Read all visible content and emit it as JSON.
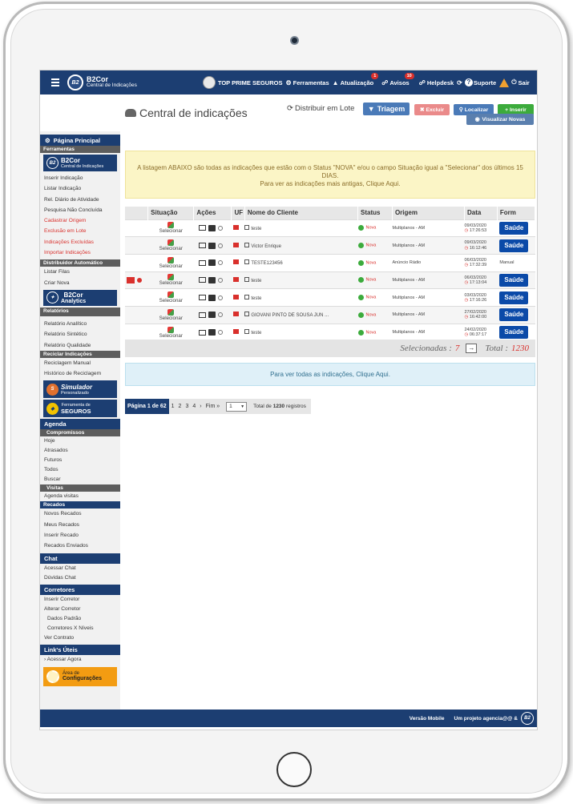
{
  "topbar": {
    "brand_name": "B2Cor",
    "brand_sub": "Central de Indicações",
    "company": "TOP PRIME SEGUROS",
    "ferramentas": "Ferramentas",
    "atualizacao": "Atualização",
    "atualizacao_badge": "1",
    "avisos": "Avisos",
    "avisos_badge": "10",
    "helpdesk": "Helpdesk",
    "suporte": "Suporte",
    "sair": "Sair"
  },
  "sidebar": {
    "main": "Página Principal",
    "ferramentas_head": "Ferramentas",
    "b2cor_banner": "B2Cor",
    "b2cor_sub": "Central de Indicações",
    "items_a": [
      {
        "label": "Inserir Indicação",
        "red": false
      },
      {
        "label": "Listar Indicação",
        "red": false
      },
      {
        "label": "Rel. Diário de Atividade",
        "red": false
      },
      {
        "label": "Pesquisa Não Concluída",
        "red": false
      },
      {
        "label": "Cadastrar Origem",
        "red": true
      },
      {
        "label": "Exclusão em Lote",
        "red": true
      },
      {
        "label": "Indicações Excluídas",
        "red": true
      },
      {
        "label": "Importar Indicações",
        "red": true
      }
    ],
    "distribuidor_head": "Distribuidor Automático",
    "listar_filas": "Listar Filas",
    "criar_nova": "Criar Nova",
    "analytics_a": "B2Cor",
    "analytics_b": "Analytics",
    "relatorios_head": "Relatórios",
    "relatorio_analitico": "Relatório Analítico",
    "relatorio_sintetico": "Relatório Sintético",
    "relatorio_qualidade": "Relatório Qualidade",
    "reciclar_head": "Reciclar Indicações",
    "reciclagem_manual": "Reciclagem Manual",
    "historico_reciclagem": "Histórico de Reciclagem",
    "simulador_a": "Simulador",
    "simulador_b": "Personalizado",
    "ferramenta_seguros_a": "Ferramenta de",
    "ferramenta_seguros_b": "SEGUROS",
    "agenda_head": "Agenda",
    "compromissos_head": "Compromissos",
    "hoje": "Hoje",
    "atrasados": "Atrasados",
    "futuros": "Futuros",
    "todos": "Todos",
    "buscar": "Buscar",
    "visitas_head": "Visitas",
    "agenda_visitas": "Agenda visitas",
    "recados_head": "Recados",
    "novos_recados": "Novos Recados",
    "meus_recados": "Meus Recados",
    "inserir_recado": "Inserir Recado",
    "recados_enviados": "Recados Enviados",
    "chat_head": "Chat",
    "acessar_chat": "Acessar Chat",
    "duvidas_chat": "Dúvidas Chat",
    "corretores_head": "Corretores",
    "inserir_corretor": "Inserir Corretor",
    "alterar_corretor": "Alterar Corretor",
    "dados_padrao": "Dados Padrão",
    "corretores_niveis": "Corretores X Níveis",
    "ver_contrato": "Ver Contrato",
    "links_head": "Link's Úteis",
    "acessar_agora": "› Acessar Agora",
    "config_a": "Área de",
    "config_b": "Configurações"
  },
  "content": {
    "title": "Central de indicações",
    "distribuir": "Distribuir em Lote",
    "triagem": "Triagem",
    "excluir": "✖ Excluir",
    "localizar": "Localizar",
    "inserir": "+ Inserir",
    "visualizar_novas": "Visualizar Novas",
    "alert_line1": "A listagem ABAIXO são todas as indicações que estão com o Status \"NOVA\" e/ou o campo Situação igual a \"Selecionar\" dos últimos 15 DIAS.",
    "alert_line2": "Para ver as indicações mais antigas, Clique Aqui.",
    "columns": [
      "Situação",
      "Ações",
      "UF",
      "Nome do Cliente",
      "Status",
      "Origem",
      "Data",
      "Form"
    ],
    "rows": [
      {
        "situacao": "Selecionar",
        "nome": "teste",
        "status": "Nova",
        "origem": "Multiplanos - AM",
        "data": "09/03/2020",
        "hora": "17:26:53",
        "form": "Saúde"
      },
      {
        "situacao": "Selecionar",
        "nome": "Victor Enrique",
        "status": "Nova",
        "origem": "Multiplanos - AM",
        "data": "09/03/2020",
        "hora": "16:12:46",
        "form": "Saúde"
      },
      {
        "situacao": "Selecionar",
        "nome": "TESTE123456",
        "status": "Nova",
        "origem": "Anúncio Rádio",
        "data": "06/03/2020",
        "hora": "17:32:39",
        "form": "Manual"
      },
      {
        "situacao": "Selecionar",
        "nome": "teste",
        "status": "Nova",
        "origem": "Multiplanos - AM",
        "data": "06/03/2020",
        "hora": "17:13:04",
        "form": "Saúde"
      },
      {
        "situacao": "Selecionar",
        "nome": "teste",
        "status": "Nova",
        "origem": "Multiplanos - AM",
        "data": "03/03/2020",
        "hora": "17:16:26",
        "form": "Saúde"
      },
      {
        "situacao": "Selecionar",
        "nome": "GIOVANI PINTO DE SOUSA JUN ...",
        "status": "Nova",
        "origem": "Multiplanos - AM",
        "data": "27/02/2020",
        "hora": "16:42:00",
        "form": "Saúde"
      },
      {
        "situacao": "Selecionar",
        "nome": "teste",
        "status": "Nova",
        "origem": "Multiplanos - AM",
        "data": "24/02/2020",
        "hora": "06:37:17",
        "form": "Saúde"
      }
    ],
    "selecionadas_label": "Selecionadas :",
    "selecionadas_value": "7",
    "total_label": "Total :",
    "total_value": "1230",
    "alert_blue": "Para ver todas as indicações, Clique Aqui.",
    "pager_current": "Página 1 de 62",
    "pager_pages": [
      "1",
      "2",
      "3",
      "4",
      "›",
      "Fim »"
    ],
    "pager_select": "1",
    "pager_total_prefix": "Total de",
    "pager_total_value": "1230",
    "pager_total_suffix": "registros"
  },
  "footer": {
    "versao": "Versão Mobile",
    "projeto": "Um projeto agencia@@ &"
  }
}
